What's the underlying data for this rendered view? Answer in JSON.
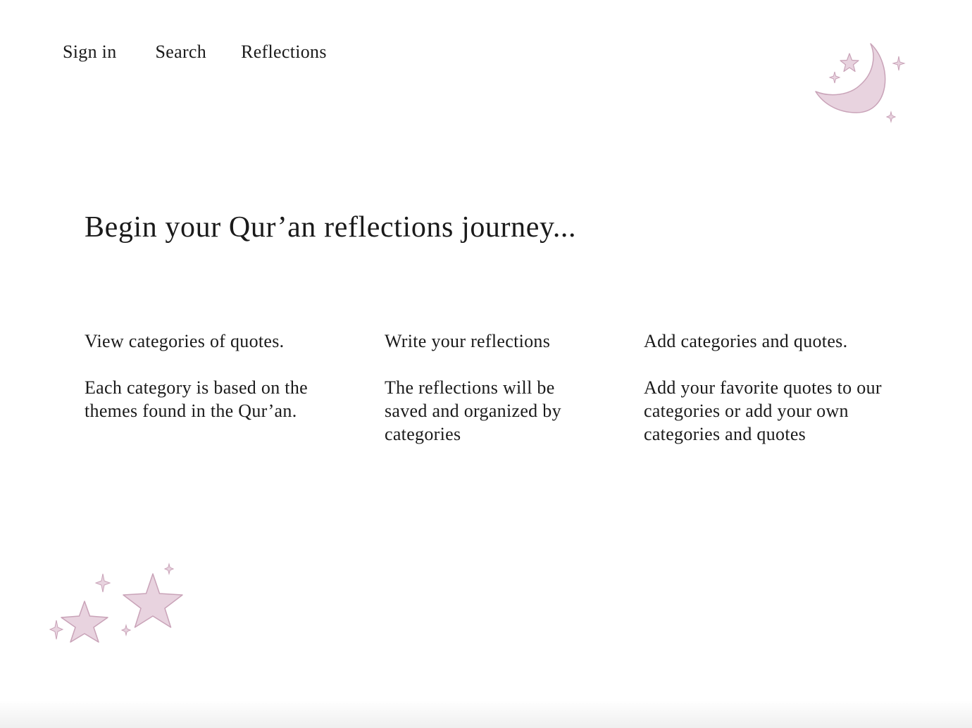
{
  "nav": {
    "items": [
      {
        "label": "Sign in"
      },
      {
        "label": "Search"
      },
      {
        "label": "Reflections"
      }
    ]
  },
  "hero": {
    "title": "Begin your Qur’an reflections journey..."
  },
  "features": [
    {
      "heading": "View categories of quotes.",
      "text": "Each category is based on the themes found in the Qur’an."
    },
    {
      "heading": "Write your reflections",
      "text": "The reflections will be saved and organized by categories"
    },
    {
      "heading": "Add categories and quotes.",
      "text": "Add your favorite quotes to our categories or add your own categories and quotes"
    }
  ],
  "decorations": {
    "moon_icon": "crescent-moon-stars-icon",
    "stars_icon": "stars-cluster-icon",
    "fill_color": "#e8d3df",
    "stroke_color": "#c9a3b8"
  }
}
